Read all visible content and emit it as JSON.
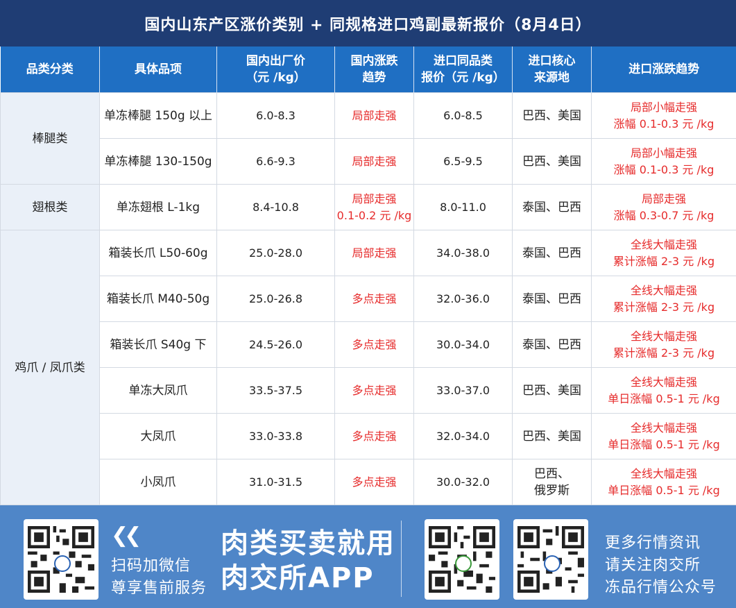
{
  "title": "国内山东产区涨价类别 + 同规格进口鸡副最新报价（8月4日）",
  "table": {
    "headers": {
      "category": "品类分类",
      "item": "具体品项",
      "domestic_price_l1": "国内出厂价",
      "domestic_price_l2": "（元 /kg）",
      "domestic_trend_l1": "国内涨跌",
      "domestic_trend_l2": "趋势",
      "import_price_l1": "进口同品类",
      "import_price_l2": "报价（元 /kg）",
      "origin_l1": "进口核心",
      "origin_l2": "来源地",
      "import_trend": "进口涨跌趋势"
    },
    "categories": {
      "drumstick": "棒腿类",
      "wingroot": "翅根类",
      "feet": "鸡爪 / 凤爪类"
    },
    "rows": [
      {
        "item": "单冻棒腿 150g 以上",
        "domestic_price": "6.0-8.3",
        "domestic_trend_1": "局部走强",
        "domestic_trend_2": "",
        "import_price": "6.0-8.5",
        "origin_1": "巴西、美国",
        "origin_2": "",
        "import_trend_1": "局部小幅走强",
        "import_trend_2": "涨幅 0.1-0.3 元 /kg"
      },
      {
        "item": "单冻棒腿 130-150g",
        "domestic_price": "6.6-9.3",
        "domestic_trend_1": "局部走强",
        "domestic_trend_2": "",
        "import_price": "6.5-9.5",
        "origin_1": "巴西、美国",
        "origin_2": "",
        "import_trend_1": "局部小幅走强",
        "import_trend_2": "涨幅 0.1-0.3 元 /kg"
      },
      {
        "item": "单冻翅根 L-1kg",
        "domestic_price": "8.4-10.8",
        "domestic_trend_1": "局部走强",
        "domestic_trend_2": "0.1-0.2 元 /kg",
        "import_price": "8.0-11.0",
        "origin_1": "泰国、巴西",
        "origin_2": "",
        "import_trend_1": "局部走强",
        "import_trend_2": "涨幅 0.3-0.7 元 /kg"
      },
      {
        "item": "箱装长爪 L50-60g",
        "domestic_price": "25.0-28.0",
        "domestic_trend_1": "局部走强",
        "domestic_trend_2": "",
        "import_price": "34.0-38.0",
        "origin_1": "泰国、巴西",
        "origin_2": "",
        "import_trend_1": "全线大幅走强",
        "import_trend_2": "累计涨幅 2-3 元 /kg"
      },
      {
        "item": "箱装长爪 M40-50g",
        "domestic_price": "25.0-26.8",
        "domestic_trend_1": "多点走强",
        "domestic_trend_2": "",
        "import_price": "32.0-36.0",
        "origin_1": "泰国、巴西",
        "origin_2": "",
        "import_trend_1": "全线大幅走强",
        "import_trend_2": "累计涨幅 2-3 元 /kg"
      },
      {
        "item": "箱装长爪 S40g 下",
        "domestic_price": "24.5-26.0",
        "domestic_trend_1": "多点走强",
        "domestic_trend_2": "",
        "import_price": "30.0-34.0",
        "origin_1": "泰国、巴西",
        "origin_2": "",
        "import_trend_1": "全线大幅走强",
        "import_trend_2": "累计涨幅 2-3 元 /kg"
      },
      {
        "item": "单冻大凤爪",
        "domestic_price": "33.5-37.5",
        "domestic_trend_1": "多点走强",
        "domestic_trend_2": "",
        "import_price": "33.0-37.0",
        "origin_1": "巴西、美国",
        "origin_2": "",
        "import_trend_1": "全线大幅走强",
        "import_trend_2": "单日涨幅 0.5-1 元 /kg"
      },
      {
        "item": "大凤爪",
        "domestic_price": "33.0-33.8",
        "domestic_trend_1": "多点走强",
        "domestic_trend_2": "",
        "import_price": "32.0-34.0",
        "origin_1": "巴西、美国",
        "origin_2": "",
        "import_trend_1": "全线大幅走强",
        "import_trend_2": "单日涨幅 0.5-1 元 /kg"
      },
      {
        "item": "小凤爪",
        "domestic_price": "31.0-31.5",
        "domestic_trend_1": "多点走强",
        "domestic_trend_2": "",
        "import_price": "30.0-32.0",
        "origin_1": "巴西、",
        "origin_2": "俄罗斯",
        "import_trend_1": "全线大幅走强",
        "import_trend_2": "单日涨幅 0.5-1 元 /kg"
      }
    ]
  },
  "footer": {
    "scan_line1": "扫码加微信",
    "scan_line2": "尊享售前服务",
    "slogan_line1": "肉类买卖就用",
    "slogan_line2": "肉交所APP",
    "more_line1": "更多行情资讯",
    "more_line2": "请关注肉交所",
    "more_line3": "冻品行情公众号"
  },
  "colors": {
    "title_bg": "#1f3d74",
    "header_bg": "#1f6fc3",
    "category_bg": "#eaf0f8",
    "trend_red": "#e62b2b",
    "footer_bg": "#4f86c8"
  },
  "icons": [
    "qr-code-icon",
    "double-chevron-left-icon"
  ]
}
